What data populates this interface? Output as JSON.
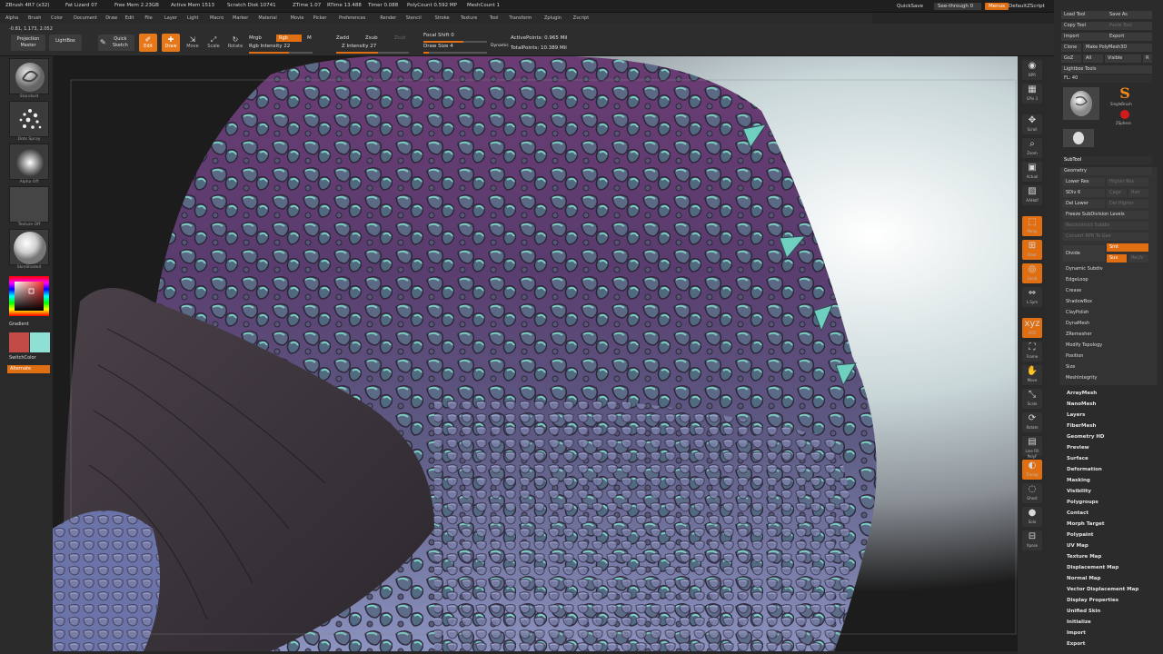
{
  "title_bar": {
    "items": [
      "ZBrush 4R7 (x32)",
      "Fat Lizard 07",
      "Free Mem 2.23GB",
      "Active Mem 1513",
      "Scratch Disk 10741",
      "ZTime 1.07",
      "RTime 13.488",
      "Timer 0.088",
      "PolyCount 0.592 MP",
      "MeshCount 1"
    ],
    "quicksave": "QuickSave",
    "seethrough": "See-through  0",
    "menus": "Menus",
    "default_script": "DefaultZScript"
  },
  "menu_bar": [
    "Alpha",
    "Brush",
    "Color",
    "Document",
    "Draw",
    "Edit",
    "File",
    "Layer",
    "Light",
    "Macro",
    "Marker",
    "Material",
    "Movie",
    "Picker",
    "Preferences",
    "Render",
    "Stencil",
    "Stroke",
    "Texture",
    "Tool",
    "Transform",
    "Zplugin",
    "Zscript"
  ],
  "toolbar": {
    "coords": "-0.81, 1.173, 2.052",
    "projection_master": "Projection Master",
    "lightbox": "LightBox",
    "quick_sketch": "Quick Sketch",
    "edit": "Edit",
    "draw": "Draw",
    "move": "Move",
    "scale": "Scale",
    "rotate": "Rotate",
    "mrgb": "Mrgb",
    "rgb": "Rgb",
    "m": "M",
    "rgb_intensity": "Rgb  Intensity 22",
    "zadd": "Zadd",
    "zsub": "Zsub",
    "zcut": "Zcut",
    "z_intensity": "Z Intensity 27",
    "focal_shift": "Focal Shift 0",
    "draw_size": "Draw Size 4",
    "dynamic": "Dynamic",
    "active_points": "ActivePoints: 0.965 Mil",
    "total_points": "TotalPoints: 10.389 Mil"
  },
  "left_tray": {
    "brush_label": "Standard",
    "stroke_label": "Dots  Spray",
    "alpha_label": "Alpha Off",
    "texture_label": "Texture Off",
    "material_label": "SkinShade4",
    "gradient": "Gradient",
    "switch_color": "SwitchColor",
    "alternate": "Alternate",
    "main_color": "#c24a47",
    "secondary_color": "#8ee0d4"
  },
  "right_shelf": [
    {
      "icon": "bpr-icon",
      "label": "BPR"
    },
    {
      "icon": "spix-icon",
      "label": "SPix 3"
    },
    {
      "icon": "scroll-icon",
      "label": "Scroll"
    },
    {
      "icon": "zoom-icon",
      "label": "Zoom"
    },
    {
      "icon": "actual-icon",
      "label": "Actual"
    },
    {
      "icon": "aahalf-icon",
      "label": "AAHalf"
    },
    {
      "icon": "persp-icon",
      "label": "Persp"
    },
    {
      "icon": "floor-icon",
      "label": "Floor"
    },
    {
      "icon": "local-icon",
      "label": "Local"
    },
    {
      "icon": "lsym-icon",
      "label": "L.Sym"
    },
    {
      "icon": "xyz-icon",
      "label": "XYZ"
    },
    {
      "icon": "frame-icon",
      "label": "Frame"
    },
    {
      "icon": "move-icon",
      "label": "Move"
    },
    {
      "icon": "scale-icon",
      "label": "Scale"
    },
    {
      "icon": "rotate-icon",
      "label": "Rotate"
    },
    {
      "icon": "linefill-icon",
      "label": "Line Fill PolyF"
    },
    {
      "icon": "transp-icon",
      "label": "Transp"
    },
    {
      "icon": "ghost-icon",
      "label": "Ghost"
    },
    {
      "icon": "solo-icon",
      "label": "Solo"
    },
    {
      "icon": "xpose-icon",
      "label": "Xpose"
    }
  ],
  "tool_panel": {
    "load_tool": "Load Tool",
    "save_as": "Save As",
    "copy_tool": "Copy Tool",
    "paste_tool": "Paste Tool",
    "import": "Import",
    "export": "Export",
    "clone": "Clone",
    "make_polymesh": "Make PolyMesh3D",
    "goz": "GoZ",
    "all": "All",
    "visible": "Visible",
    "r": "R",
    "lightbox_tools": "Lightbox  Tools",
    "tool_name": "FL: 40",
    "single_brush": "SingleBrush",
    "ztspheres": "ZSphere",
    "subtool": "SubTool",
    "geometry": "Geometry",
    "lower_res": "Lower Res",
    "higher_res": "Higher Res",
    "sdiv": "SDiv 6",
    "cage": "Cage",
    "rstr": "Rstr",
    "del_lower": "Del Lower",
    "del_higher": "Del Higher",
    "freeze_subdivision": "Freeze SubDivision Levels",
    "reconstruct_subdiv": "Reconstruct Subdiv",
    "convert_bpr": "Convert BPR To Geo",
    "divide": "Divide",
    "smt": "Smt",
    "suv": "Suv",
    "relx": "ReUV",
    "geometry_items": [
      "Dynamic Subdiv",
      "EdgeLoop",
      "Crease",
      "ShadowBox",
      "ClayPolish",
      "DynaMesh",
      "ZRemesher",
      "Modify Topology",
      "Position",
      "Size",
      "MeshIntegrity"
    ],
    "sections": [
      "ArrayMesh",
      "NanoMesh",
      "Layers",
      "FiberMesh",
      "Geometry HD",
      "Preview",
      "Surface",
      "Deformation",
      "Masking",
      "Visibility",
      "Polygroups",
      "Contact",
      "Morph Target",
      "Polypaint",
      "UV Map",
      "Texture Map",
      "Displacement Map",
      "Normal Map",
      "Vector Displacement Map",
      "Display Properties",
      "Unified Skin",
      "Initialize",
      "Import",
      "Export"
    ]
  }
}
